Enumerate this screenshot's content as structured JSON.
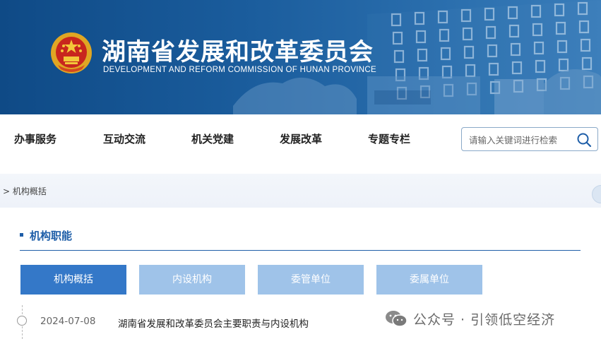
{
  "header": {
    "title": "湖南省发展和改革委员会",
    "subtitle": "DEVELOPMENT AND REFORM COMMISSION OF HUNAN PROVINCE"
  },
  "nav": {
    "items": [
      "办事服务",
      "互动交流",
      "机关党建",
      "发展改革",
      "专题专栏"
    ],
    "search_placeholder": "请输入关键词进行检索"
  },
  "breadcrumb": "> 机构概括",
  "section": {
    "title": "机构职能"
  },
  "tabs": [
    {
      "label": "机构概括",
      "active": true
    },
    {
      "label": "内设机构",
      "active": false
    },
    {
      "label": "委管单位",
      "active": false
    },
    {
      "label": "委属单位",
      "active": false
    }
  ],
  "list": [
    {
      "date": "2024-07-08",
      "title": "湖南省发展和改革委员会主要职责与内设机构"
    }
  ],
  "watermark": "公众号 · 引领低空经济",
  "colors": {
    "banner": "#1a5c9c",
    "accent": "#1e5ea8",
    "tab_active": "#3478c8",
    "tab_inactive": "#9fc3e9"
  }
}
